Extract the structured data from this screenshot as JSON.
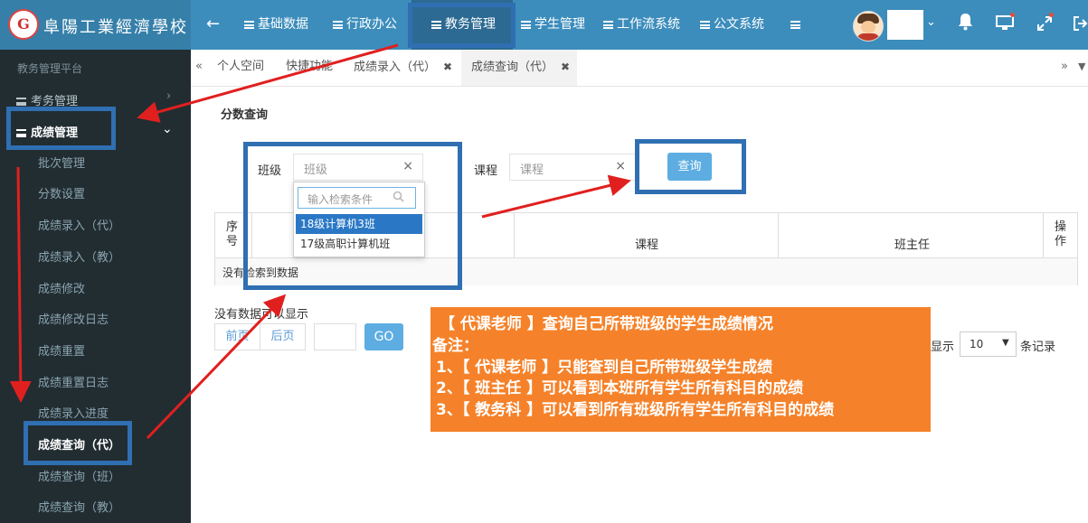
{
  "header": {
    "logo_glyph": "G",
    "school_name": "阜陽工業經濟學校",
    "back": "←",
    "nav": [
      "基础数据",
      "行政办公",
      "教务管理",
      "学生管理",
      "工作流系统",
      "公文系统"
    ],
    "active_nav": "教务管理"
  },
  "sidebar": {
    "platform": "教务管理平台",
    "group1": "考务管理",
    "group2": "成绩管理",
    "items": [
      "批次管理",
      "分数设置",
      "成绩录入（代）",
      "成绩录入（教）",
      "成绩修改",
      "成绩修改日志",
      "成绩重置",
      "成绩重置日志",
      "成绩录入进度",
      "成绩查询（代）",
      "成绩查询（班）",
      "成绩查询（教）"
    ],
    "active_item": "成绩查询（代）"
  },
  "tabs": {
    "items": [
      "个人空间",
      "快捷功能",
      "成绩录入（代）",
      "成绩查询（代）"
    ],
    "close": "✖",
    "left_scroll": "«",
    "right_scroll": "»"
  },
  "main": {
    "section_title": "分数查询",
    "class_label": "班级",
    "class_placeholder": "班级",
    "course_label": "课程",
    "course_placeholder": "课程",
    "clear": "×",
    "query_button": "查询",
    "dropdown": {
      "search_placeholder": "输入检索条件",
      "options": [
        "18级计算机3班",
        "17级高职计算机班"
      ],
      "selected": "18级计算机3班"
    },
    "table": {
      "headers": [
        "序号",
        "课程",
        "班主任",
        "操作"
      ],
      "empty": "没有检索到数据"
    },
    "pager": {
      "info": "没有数据可以显示",
      "prev": "前页",
      "next": "后页",
      "go": "GO",
      "show_label": "显示",
      "page_size": "10",
      "records_label": "条记录"
    }
  },
  "annotation": {
    "lines": [
      "【 代课老师 】查询自己所带班级的学生成绩情况",
      "备注：",
      " 1、【 代课老师 】只能查到自己所带班级学生成绩",
      " 2、【 班主任 】可以看到本班所有学生所有科目的成绩",
      " 3、【 教务科 】可以看到所有班级所有学生所有科目的成绩"
    ],
    "box_color": "#f5822a",
    "frame_color": "#2f6fb2",
    "arrow_color": "#e0201f"
  }
}
